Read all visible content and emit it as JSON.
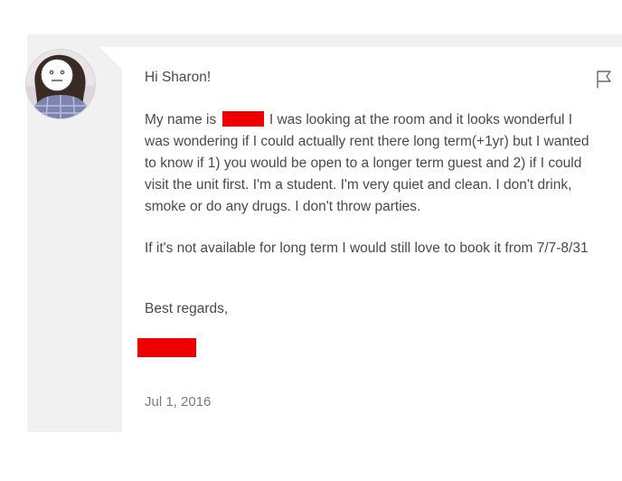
{
  "message": {
    "greeting": "Hi Sharon!",
    "intro_prefix": "My name is",
    "intro_body": "I was looking at the room and it looks wonderful I was wondering if I could actually rent there long term(+1yr) but I wanted to know if 1) you would be open to a longer term guest and 2) if I could visit the unit first. I'm a student. I'm very quiet and clean. I don't drink, smoke or do any drugs. I don't throw parties.",
    "paragraph2": "If it's not available for long term I would still love to book it from 7/7-8/31",
    "signoff": "Best regards,",
    "date": "Jul 1, 2016"
  },
  "icons": {
    "report": "flag-icon",
    "avatar": "user-avatar"
  },
  "colors": {
    "redaction": "#ee0000",
    "text": "#4a4a4a",
    "date": "#7b7b7b",
    "panel": "#f1f1f1"
  }
}
